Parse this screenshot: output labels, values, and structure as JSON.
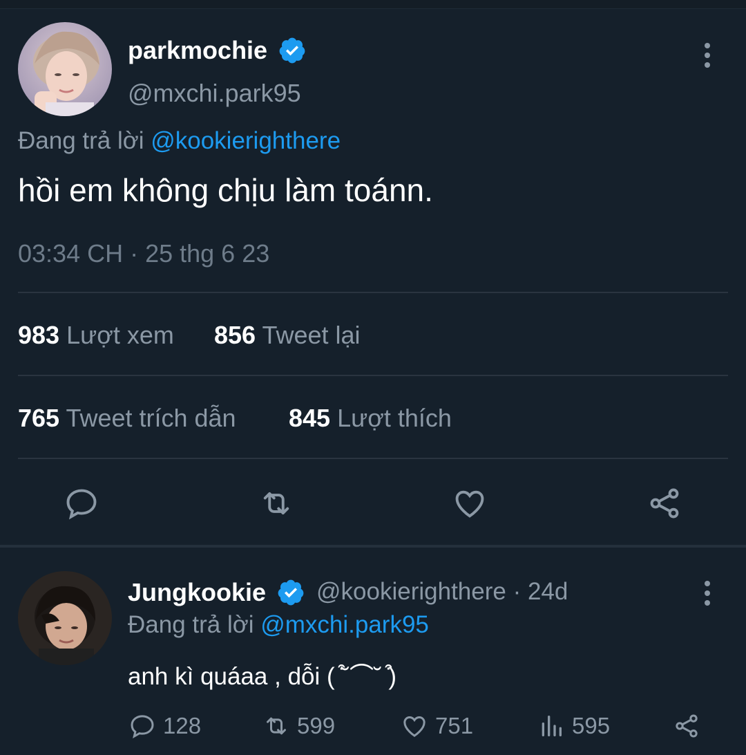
{
  "tweet": {
    "author_name": "parkmochie",
    "author_handle": "@mxchi.park95",
    "replying_prefix": "Đang trả lời",
    "replying_to": "@kookierighthere",
    "text": "hồi em không chịu làm toánn.",
    "timestamp": "03:34 CH · 25 thg 6 23",
    "stats": {
      "views_count": "983",
      "views_label": "Lượt xem",
      "retweets_count": "856",
      "retweets_label": "Tweet lại",
      "quotes_count": "765",
      "quotes_label": "Tweet trích dẫn",
      "likes_count": "845",
      "likes_label": "Lượt thích"
    },
    "actions": [
      "reply-icon",
      "retweet-icon",
      "like-icon",
      "share-icon"
    ]
  },
  "reply": {
    "author_name": "Jungkookie",
    "author_handle": "@kookierighthere",
    "time": "· 24d",
    "replying_prefix": "Đang trả lời",
    "replying_to": "@mxchi.park95",
    "text": "anh kì quáaa , dỗi ( ͒˘⌒˘ ͒)",
    "counts": {
      "replies": "128",
      "retweets": "599",
      "likes": "751",
      "views": "595"
    }
  },
  "colors": {
    "background": "#15202b",
    "accent": "#1d9bf0",
    "muted_text": "#8b98a5",
    "divider": "#2a3440"
  }
}
